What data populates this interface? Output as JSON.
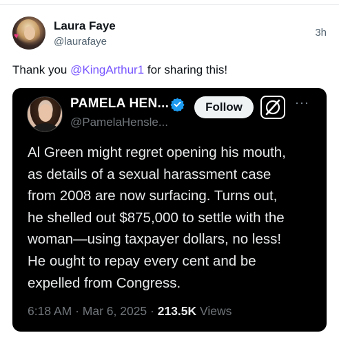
{
  "post": {
    "author_name": "Laura Faye",
    "author_handle": "@laurafaye",
    "timestamp": "3h",
    "text_prefix": "Thank you ",
    "mention": "@KingArthur1",
    "text_suffix": " for sharing this!"
  },
  "quoted_post": {
    "author_name": "PAMELA HEN...",
    "author_handle": "@PamelaHensle...",
    "verified_icon": "verified-badge-icon",
    "verified_color": "#1d9bf0",
    "follow_label": "Follow",
    "more_label": "···",
    "body_lines": [
      "Al Green might regret opening his mouth,",
      "as details of a sexual harassment case",
      "from 2008 are now surfacing. Turns out,",
      "he shelled out $875,000 to settle with the",
      "woman—using taxpayer dollars, no less!",
      "He ought to repay every cent and be",
      "expelled from Congress."
    ],
    "time": "6:18 AM",
    "date": "Mar 6, 2025",
    "separator": " · ",
    "views_count": "213.5K",
    "views_label": " Views"
  },
  "colors": {
    "mention": "#7856ff",
    "quote_bg": "#000000"
  }
}
